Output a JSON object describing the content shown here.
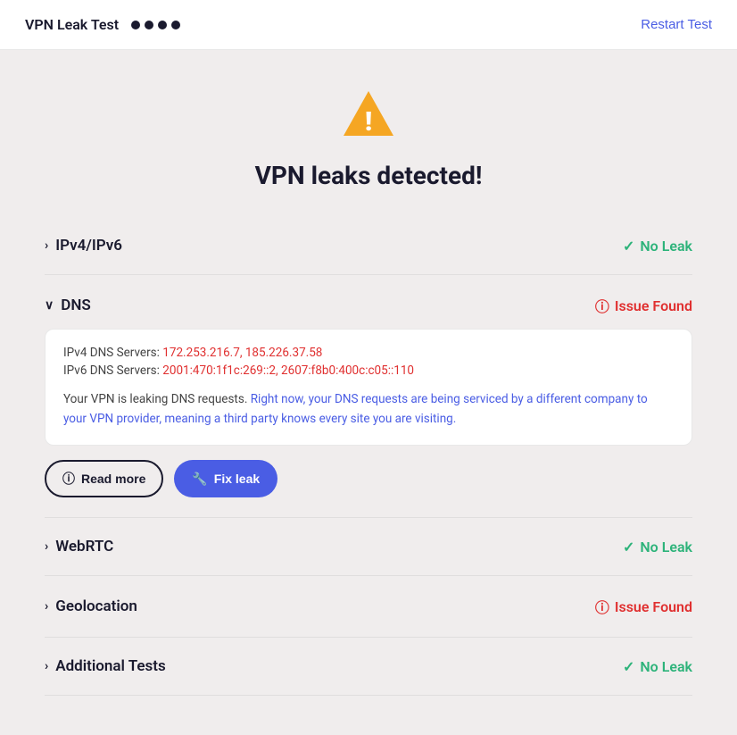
{
  "header": {
    "title": "VPN Leak Test",
    "restart_label": "Restart Test"
  },
  "hero": {
    "title": "VPN leaks detected!"
  },
  "sections": [
    {
      "id": "ipv4ipv6",
      "label": "IPv4/IPv6",
      "status": "no-leak",
      "status_label": "No Leak",
      "expanded": false
    },
    {
      "id": "dns",
      "label": "DNS",
      "status": "issue",
      "status_label": "Issue Found",
      "expanded": true,
      "dns_ipv4_label": "IPv4 DNS Servers:",
      "dns_ipv4_values": "172.253.216.7, 185.226.37.58",
      "dns_ipv6_label": "IPv6 DNS Servers:",
      "dns_ipv6_values": "2001:470:1f1c:269::2, 2607:f8b0:400c:c05::110",
      "description_plain": "Your VPN is leaking DNS requests. ",
      "description_highlight": "Right now, your DNS requests are being serviced by a different company to your VPN provider, meaning a third party knows every site you are visiting.",
      "read_more_label": "Read more",
      "fix_leak_label": "Fix leak"
    },
    {
      "id": "webrtc",
      "label": "WebRTC",
      "status": "no-leak",
      "status_label": "No Leak",
      "expanded": false
    },
    {
      "id": "geolocation",
      "label": "Geolocation",
      "status": "issue",
      "status_label": "Issue Found",
      "expanded": false
    },
    {
      "id": "additional",
      "label": "Additional Tests",
      "status": "no-leak",
      "status_label": "No Leak",
      "expanded": false
    }
  ]
}
